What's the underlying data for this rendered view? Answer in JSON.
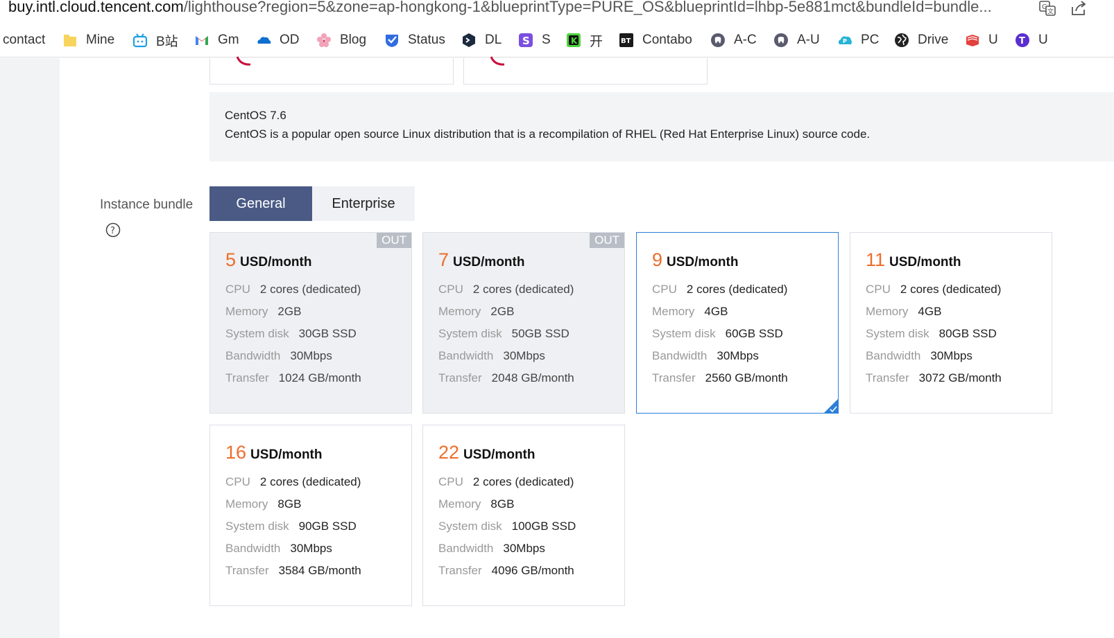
{
  "browser": {
    "url_host": "buy.intl.cloud.tencent.com",
    "url_path": "/lighthouse?region=5&zone=ap-hongkong-1&blueprintType=PURE_OS&blueprintId=lhbp-5e881mct&bundleId=bundle..."
  },
  "bookmarks": [
    {
      "label": "contact",
      "icon": "none"
    },
    {
      "label": "Mine",
      "icon": "folder-icon"
    },
    {
      "label": "B站",
      "icon": "bilibili-icon"
    },
    {
      "label": "Gm",
      "icon": "gmail-icon"
    },
    {
      "label": "OD",
      "icon": "onedrive-icon"
    },
    {
      "label": "Blog",
      "icon": "blossom-icon"
    },
    {
      "label": "Status",
      "icon": "check-shield-icon"
    },
    {
      "label": "DL",
      "icon": "terminal-icon"
    },
    {
      "label": "S",
      "icon": "s-app-icon"
    },
    {
      "label": "开",
      "icon": "k-app-icon"
    },
    {
      "label": "Contabo",
      "icon": "bt-icon"
    },
    {
      "label": "A-C",
      "icon": "tooth-icon"
    },
    {
      "label": "A-U",
      "icon": "tooth-icon"
    },
    {
      "label": "PC",
      "icon": "cloud-p-icon"
    },
    {
      "label": "Drive",
      "icon": "globe-icon"
    },
    {
      "label": "U",
      "icon": "book-icon"
    },
    {
      "label": "U",
      "icon": "t-icon"
    }
  ],
  "os": {
    "name": "CentOS 7.6",
    "description": "CentOS is a popular open source Linux distribution that is a recompilation of RHEL (Red Hat Enterprise Linux) source code."
  },
  "bundle": {
    "label": "Instance bundle",
    "tabs": [
      {
        "label": "General",
        "active": true
      },
      {
        "label": "Enterprise",
        "active": false
      }
    ],
    "unit": "USD/month",
    "spec_labels": {
      "cpu": "CPU",
      "memory": "Memory",
      "disk": "System disk",
      "bandwidth": "Bandwidth",
      "transfer": "Transfer"
    },
    "soldout_badge": "OUT",
    "cards": [
      {
        "price": "5",
        "cpu": "2 cores (dedicated)",
        "memory": "2GB",
        "disk": "30GB SSD",
        "bandwidth": "30Mbps",
        "transfer": "1024 GB/month",
        "soldout": true,
        "selected": false
      },
      {
        "price": "7",
        "cpu": "2 cores (dedicated)",
        "memory": "2GB",
        "disk": "50GB SSD",
        "bandwidth": "30Mbps",
        "transfer": "2048 GB/month",
        "soldout": true,
        "selected": false
      },
      {
        "price": "9",
        "cpu": "2 cores (dedicated)",
        "memory": "4GB",
        "disk": "60GB SSD",
        "bandwidth": "30Mbps",
        "transfer": "2560 GB/month",
        "soldout": false,
        "selected": true
      },
      {
        "price": "11",
        "cpu": "2 cores (dedicated)",
        "memory": "4GB",
        "disk": "80GB SSD",
        "bandwidth": "30Mbps",
        "transfer": "3072 GB/month",
        "soldout": false,
        "selected": false
      },
      {
        "price": "16",
        "cpu": "2 cores (dedicated)",
        "memory": "8GB",
        "disk": "90GB SSD",
        "bandwidth": "30Mbps",
        "transfer": "3584 GB/month",
        "soldout": false,
        "selected": false
      },
      {
        "price": "22",
        "cpu": "2 cores (dedicated)",
        "memory": "8GB",
        "disk": "100GB SSD",
        "bandwidth": "30Mbps",
        "transfer": "4096 GB/month",
        "soldout": false,
        "selected": false
      }
    ]
  },
  "colors": {
    "accent": "#4a5a85",
    "price": "#ef6c2a",
    "selected_border": "#2b7fd9",
    "soldout_bg": "#eef0f3"
  }
}
